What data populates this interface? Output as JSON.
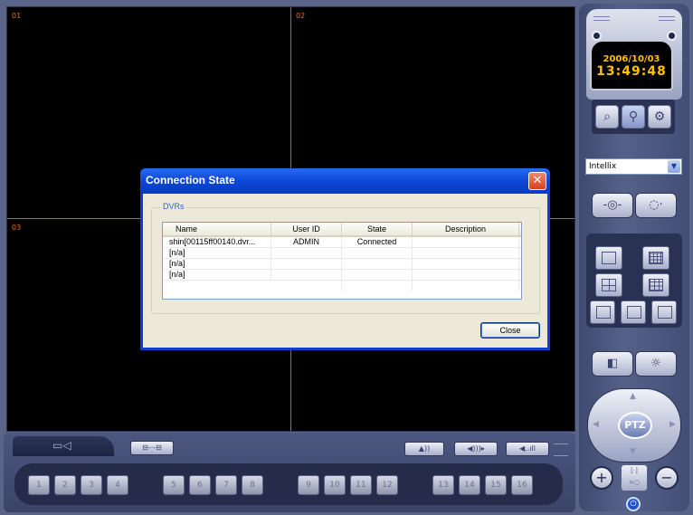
{
  "video": {
    "channels": [
      {
        "id": "01"
      },
      {
        "id": "02"
      },
      {
        "id": "03"
      }
    ]
  },
  "clock": {
    "date": "2006/10/03",
    "time": "13:49:48"
  },
  "site_select": {
    "value": "Intellix"
  },
  "ptz": {
    "label": "PTZ"
  },
  "channel_buttons": [
    "1",
    "2",
    "3",
    "4",
    "5",
    "6",
    "7",
    "8",
    "9",
    "10",
    "11",
    "12",
    "13",
    "14",
    "15",
    "16"
  ],
  "dialog": {
    "title": "Connection State",
    "group_label": "DVRs",
    "columns": [
      "Name",
      "User ID",
      "State",
      "Description"
    ],
    "rows": [
      {
        "name": "shin[00115ff00140.dvr...",
        "user_id": "ADMIN",
        "state": "Connected",
        "description": ""
      },
      {
        "name": "[n/a]",
        "user_id": "",
        "state": "",
        "description": ""
      },
      {
        "name": "[n/a]",
        "user_id": "",
        "state": "",
        "description": ""
      },
      {
        "name": "[n/a]",
        "user_id": "",
        "state": "",
        "description": ""
      }
    ],
    "close_label": "Close"
  },
  "colors": {
    "accent": "#0a3fd0",
    "clock_text": "#ffc000",
    "channel_label": "#e0701a",
    "divider": "#2f8fa6"
  }
}
